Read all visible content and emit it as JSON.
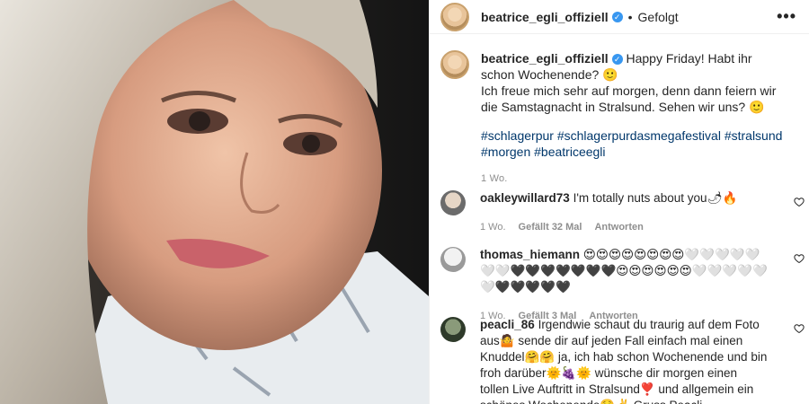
{
  "post": {
    "author": "beatrice_egli_offiziell",
    "verified_glyph": "✓",
    "dot": "•",
    "follow_label": "Gefolgt",
    "more_label": "•••",
    "caption_line1": "Happy Friday! Habt ihr schon Wochenende? 🙂",
    "caption_line2": "Ich freue mich sehr auf morgen, denn dann feiern wir die Samstagnacht in Stralsund. Sehen wir uns? 🙂",
    "hashtags": "#schlagerpur #schlagerpurdasmegafestival #stralsund #morgen #beatriceegli",
    "age": "1 Wo."
  },
  "comments": [
    {
      "user": "oakleywillard73",
      "text": "I'm totally nuts about you🌶🔥",
      "age": "1 Wo.",
      "likes": "Gefällt 32 Mal",
      "reply": "Antworten"
    },
    {
      "user": "thomas_hiemann",
      "text": "😍😍😍😍😍😍😍😍🤍🤍🤍🤍🤍🤍🤍🖤🖤🖤🖤🖤🖤🖤😍😍😍😍😍😍🤍🤍🤍🤍🤍🤍🖤🖤🖤🖤🖤",
      "age": "1 Wo.",
      "likes": "Gefällt 3 Mal",
      "reply": "Antworten"
    },
    {
      "user": "peacli_86",
      "text": "Irgendwie schaut du traurig auf dem Foto aus🤷 sende dir auf jeden Fall einfach mal einen Knuddel🤗🤗 ja, ich hab schon Wochenende und bin froh darüber🌞🍇🌞 wünsche dir morgen einen tollen Live Auftritt in Stralsund❣️ und allgemein ein schönes Wochenende☺️✌️ Gruss Peacli"
    }
  ],
  "icons": {
    "heart": "heart-outline-icon"
  },
  "colors": {
    "hashtag": "#00376b",
    "verified": "#3897f0",
    "meta": "#8e8e8e"
  }
}
